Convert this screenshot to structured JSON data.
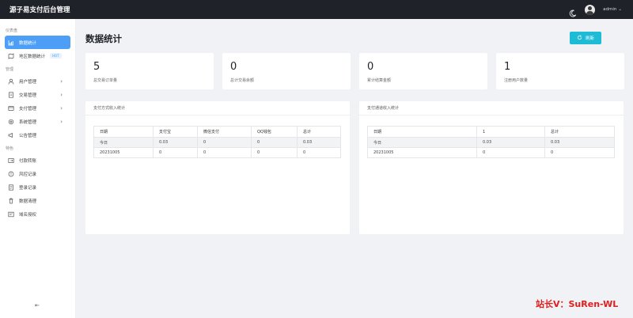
{
  "app": {
    "title": "源子易支付后台管理"
  },
  "user": {
    "name": "admin"
  },
  "sidebar": {
    "sections": [
      {
        "label": "仪表盘",
        "items": [
          {
            "label": "数据统计",
            "active": true
          },
          {
            "label": "地区数据统计",
            "badge": "HOT"
          }
        ]
      },
      {
        "label": "管理",
        "items": [
          {
            "label": "用户管理"
          },
          {
            "label": "交易管理"
          },
          {
            "label": "支付管理"
          },
          {
            "label": "系统管理"
          },
          {
            "label": "公告管理"
          }
        ]
      },
      {
        "label": "特色",
        "items": [
          {
            "label": "付款转账"
          },
          {
            "label": "风控记录"
          },
          {
            "label": "登录记录"
          },
          {
            "label": "数据清理"
          },
          {
            "label": "域名授权"
          }
        ]
      }
    ]
  },
  "page": {
    "title": "数据统计",
    "refresh_label": "刷新"
  },
  "stats": [
    {
      "value": "5",
      "label": "总交易订单量"
    },
    {
      "value": "0",
      "label": "总计交易余额"
    },
    {
      "value": "0",
      "label": "累计结算金额"
    },
    {
      "value": "1",
      "label": "注册用户数量"
    }
  ],
  "panels": {
    "left": {
      "title": "支付方式收入统计",
      "headers": [
        "日期",
        "支付宝",
        "微信支付",
        "QQ钱包",
        "总计"
      ],
      "rows": [
        [
          "今日",
          "0.03",
          "0",
          "0",
          "0.03"
        ],
        [
          "20231005",
          "0",
          "0",
          "0",
          "0"
        ]
      ]
    },
    "right": {
      "title": "支付通道收入统计",
      "headers": [
        "日期",
        "1",
        "总计"
      ],
      "rows": [
        [
          "今日",
          "0.03",
          "0.03"
        ],
        [
          "20231005",
          "0",
          "0"
        ]
      ]
    }
  },
  "watermark": "站长V：SuRen-WL",
  "colors": {
    "accent": "#4d9ef7",
    "refresh": "#1ebbd7",
    "topbar": "#1f2329",
    "watermark": "#e11d1d"
  }
}
